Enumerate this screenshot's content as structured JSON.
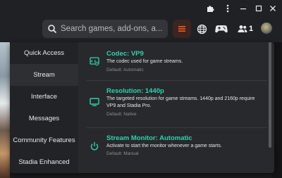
{
  "browser": {
    "icons": [
      "puzzle-icon",
      "kebab-menu-icon"
    ],
    "window_controls": [
      "minimize-icon",
      "restore-icon",
      "close-icon"
    ]
  },
  "topbar": {
    "search": {
      "placeholder": "Search games, add-ons, a...",
      "value": ""
    },
    "friends_count": "1",
    "accent_color": "#ff5722"
  },
  "sidebar": {
    "items": [
      {
        "label": "Quick Access"
      },
      {
        "label": "Stream"
      },
      {
        "label": "Interface"
      },
      {
        "label": "Messages"
      },
      {
        "label": "Community Features"
      },
      {
        "label": "Stadia Enhanced"
      }
    ],
    "active_index": 1
  },
  "settings": [
    {
      "icon": "codec-settings-icon",
      "title": "Codec: VP9",
      "description": "The codec used for game streams.",
      "default": "Default: Automatic"
    },
    {
      "icon": "monitor-icon",
      "title": "Resolution: 1440p",
      "description": "The targeted resolution for game streams. 1440p and 2160p require VP9 and Stadia Pro.",
      "default": "Default: Native"
    },
    {
      "icon": "power-icon",
      "title": "Stream Monitor: Automatic",
      "description": "Activate to start the monitor whenever a game starts.",
      "default": "Default: Manual"
    }
  ],
  "theme": {
    "setting_title_color": "#2dd3b0",
    "panel_bg": "#28292c"
  }
}
